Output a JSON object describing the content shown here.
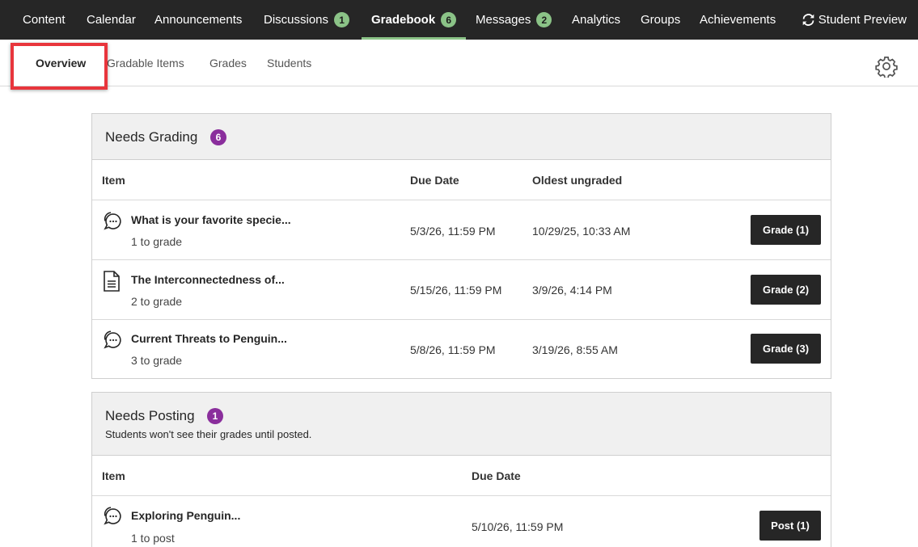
{
  "topnav": {
    "items": [
      {
        "label": "Content",
        "badge": ""
      },
      {
        "label": "Calendar",
        "badge": ""
      },
      {
        "label": "Announcements",
        "badge": ""
      },
      {
        "label": "Discussions",
        "badge": "1"
      },
      {
        "label": "Gradebook",
        "badge": "6"
      },
      {
        "label": "Messages",
        "badge": "2"
      },
      {
        "label": "Analytics",
        "badge": ""
      },
      {
        "label": "Groups",
        "badge": ""
      },
      {
        "label": "Achievements",
        "badge": ""
      }
    ],
    "preview_label": "Student Preview"
  },
  "subnav": {
    "tabs": [
      "Overview",
      "Gradable Items",
      "Grades",
      "Students"
    ]
  },
  "needs_grading": {
    "title": "Needs Grading",
    "count": "6",
    "headers": {
      "item": "Item",
      "due": "Due Date",
      "oldest": "Oldest ungraded"
    },
    "rows": [
      {
        "icon": "discussion-icon",
        "title": "What is your favorite specie...",
        "sub": "1 to grade",
        "due": "5/3/26, 11:59 PM",
        "oldest": "10/29/25, 10:33 AM",
        "button": "Grade (1)"
      },
      {
        "icon": "document-icon",
        "title": "The Interconnectedness of...",
        "sub": "2 to grade",
        "due": "5/15/26, 11:59 PM",
        "oldest": "3/9/26, 4:14 PM",
        "button": "Grade (2)"
      },
      {
        "icon": "discussion-icon",
        "title": "Current Threats to Penguin...",
        "sub": "3 to grade",
        "due": "5/8/26, 11:59 PM",
        "oldest": "3/19/26, 8:55 AM",
        "button": "Grade (3)"
      }
    ]
  },
  "needs_posting": {
    "title": "Needs Posting",
    "count": "1",
    "subtitle": "Students won't see their grades until posted.",
    "headers": {
      "item": "Item",
      "due": "Due Date"
    },
    "rows": [
      {
        "icon": "discussion-icon",
        "title": "Exploring Penguin...",
        "sub": "1 to post",
        "due": "5/10/26, 11:59 PM",
        "button": "Post (1)"
      }
    ]
  },
  "colors": {
    "nav_bg": "#262626",
    "nav_badge": "#8bc387",
    "count_badge": "#8a2e9c",
    "highlight": "#e8353c"
  }
}
